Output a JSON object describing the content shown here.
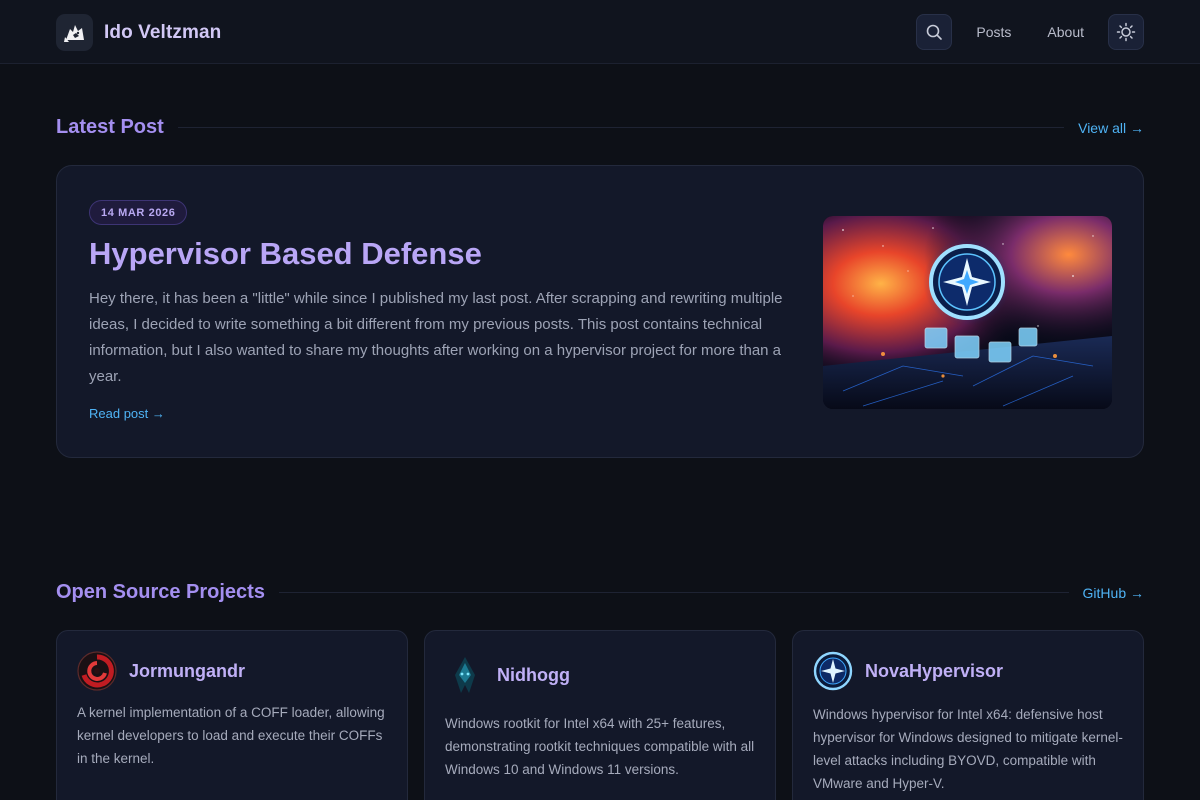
{
  "header": {
    "brand_name": "Ido Veltzman",
    "nav": [
      {
        "label": "Posts"
      },
      {
        "label": "About"
      }
    ],
    "icons": {
      "search": "search-icon",
      "theme": "sun-icon"
    }
  },
  "latest": {
    "section_title": "Latest Post",
    "view_all_label": "View all →",
    "post": {
      "date": "14 MAR 2026",
      "title": "Hypervisor Based Defense",
      "excerpt": "Hey there, it has been a \"little\" while since I published my last post. After scrapping and rewriting multiple ideas, I decided to write something a bit different from my previous posts. This post contains technical information, but I also wanted to share my thoughts after working on a hypervisor project for more than a year.",
      "read_label": "Read post →"
    }
  },
  "projects": {
    "section_title": "Open Source Projects",
    "github_label": "GitHub →",
    "items": [
      {
        "name": "Jormungandr",
        "description": "A kernel implementation of a COFF loader, allowing kernel developers to load and execute their COFFs in the kernel."
      },
      {
        "name": "Nidhogg",
        "description": "Windows rootkit for Intel x64 with 25+ features, demonstrating rootkit techniques compatible with all Windows 10 and Windows 11 versions."
      },
      {
        "name": "NovaHypervisor",
        "description": "Windows hypervisor for Intel x64: defensive host hypervisor for Windows designed to mitigate kernel-level attacks including BYOVD, compatible with VMware and Hyper-V."
      }
    ]
  },
  "colors": {
    "background": "#0d1017",
    "accent_purple": "#a48ff0",
    "link_blue": "#4fb3f5",
    "card_bg": "#131829"
  }
}
